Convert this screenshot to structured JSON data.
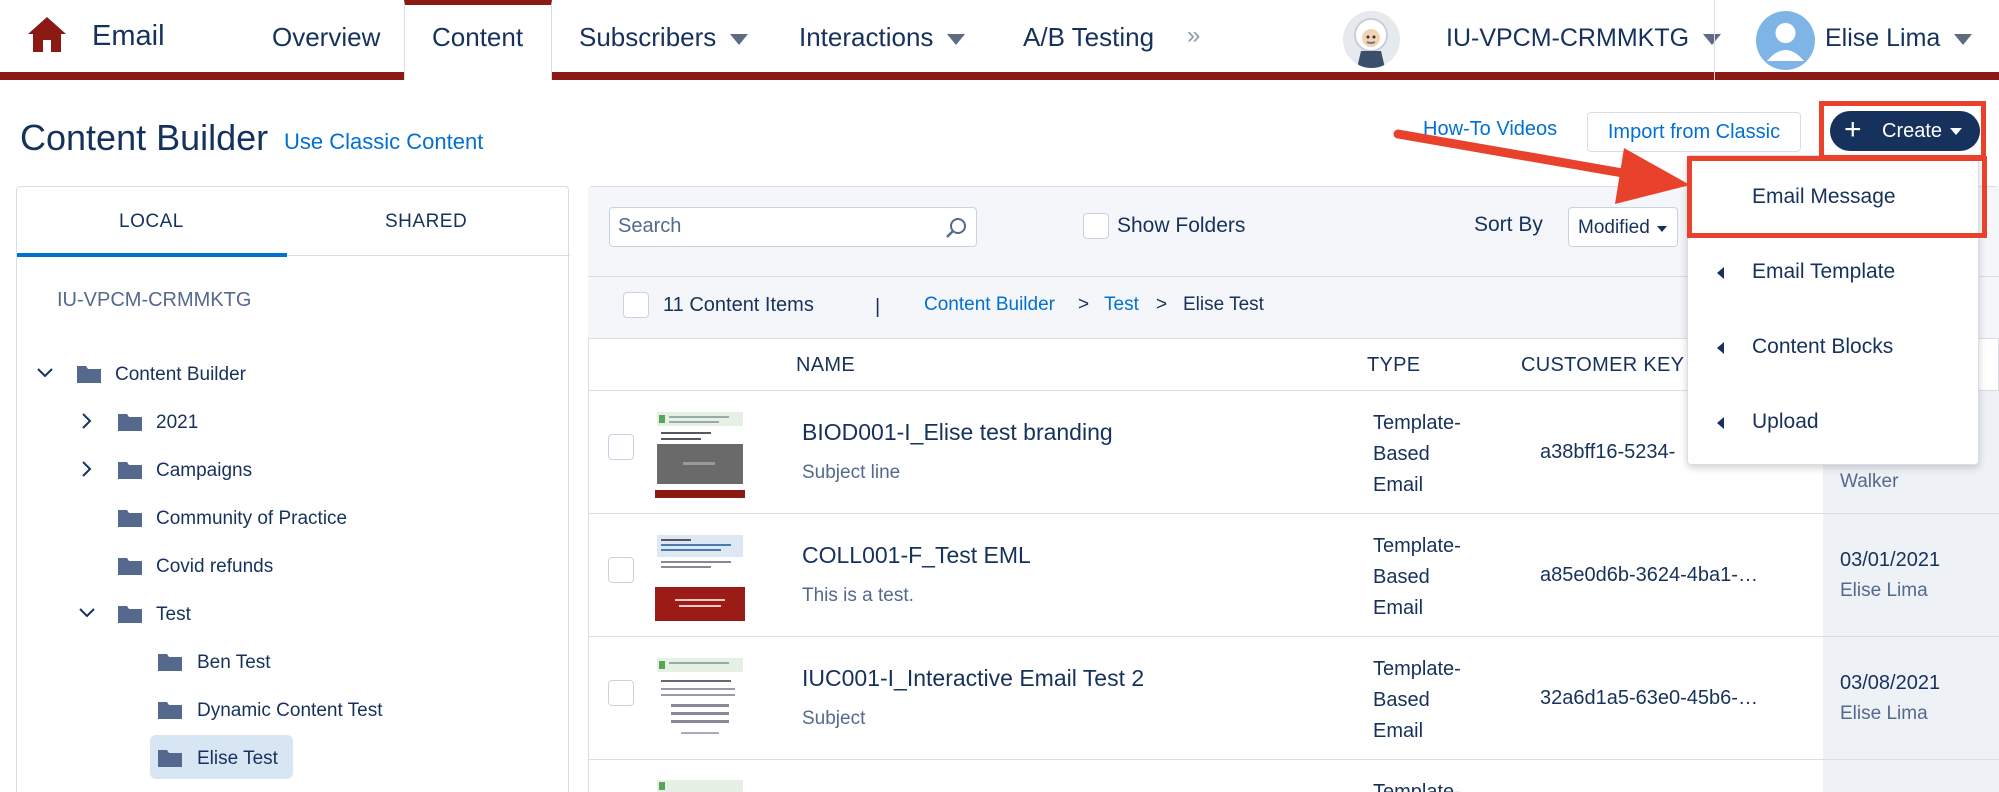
{
  "nav": {
    "app_name": "Email",
    "tabs": [
      {
        "label": "Overview",
        "active": false,
        "has_caret": false
      },
      {
        "label": "Content",
        "active": true,
        "has_caret": false
      },
      {
        "label": "Subscribers",
        "active": false,
        "has_caret": true
      },
      {
        "label": "Interactions",
        "active": false,
        "has_caret": true
      },
      {
        "label": "A/B Testing",
        "active": false,
        "has_caret": false
      }
    ],
    "more_glyph": "»",
    "org_name": "IU-VPCM-CRMMKTG",
    "user_name": "Elise Lima",
    "icons": {
      "home": "home-icon",
      "org": "einstein-avatar",
      "user": "user-avatar-icon"
    }
  },
  "header": {
    "title": "Content Builder",
    "classic_link": "Use Classic Content",
    "howto_link": "How-To Videos",
    "import_button": "Import from Classic",
    "create_button": "Create"
  },
  "left_panel": {
    "tabs": [
      "LOCAL",
      "SHARED"
    ],
    "active_tab": "LOCAL",
    "org_label": "IU-VPCM-CRMMKTG",
    "tree": [
      {
        "label": "Content Builder",
        "level": 0,
        "expanded": true
      },
      {
        "label": "2021",
        "level": 1,
        "collapsed": true
      },
      {
        "label": "Campaigns",
        "level": 1,
        "collapsed": true
      },
      {
        "label": "Community of Practice",
        "level": 1
      },
      {
        "label": "Covid refunds",
        "level": 1
      },
      {
        "label": "Test",
        "level": 1,
        "expanded": true
      },
      {
        "label": "Ben Test",
        "level": 2
      },
      {
        "label": "Dynamic Content Test",
        "level": 2
      },
      {
        "label": "Elise Test",
        "level": 2,
        "selected": true
      }
    ]
  },
  "toolbar": {
    "search_placeholder": "Search",
    "show_folders": "Show Folders",
    "sort_by_label": "Sort By",
    "sort_value": "Modified"
  },
  "list": {
    "count_label": "11 Content Items",
    "separator": "|",
    "breadcrumb": [
      "Content Builder",
      "Test",
      "Elise Test"
    ],
    "crumb_sep": ">",
    "columns": [
      "NAME",
      "TYPE",
      "CUSTOMER KEY"
    ],
    "rows": [
      {
        "name": "BIOD001-I_Elise test branding",
        "subject": "Subject line",
        "type": "Template-Based Email",
        "key": "a38bff16-5234-",
        "date": "",
        "by": "Walker"
      },
      {
        "name": "COLL001-F_Test EML",
        "subject": "This is a test.",
        "type": "Template-Based Email",
        "key": "a85e0d6b-3624-4ba1-…",
        "date": "03/01/2021",
        "by": "Elise Lima"
      },
      {
        "name": "IUC001-I_Interactive Email Test 2",
        "subject": "Subject",
        "type": "Template-Based Email",
        "key": "32a6d1a5-63e0-45b6-…",
        "date": "03/08/2021",
        "by": "Elise Lima"
      },
      {
        "name": "",
        "subject": "",
        "type": "Template-",
        "key": "",
        "date": "",
        "by": ""
      }
    ]
  },
  "create_menu": {
    "items": [
      "Email Message",
      "Email Template",
      "Content Blocks",
      "Upload"
    ]
  },
  "colors": {
    "brand_navy": "#16325c",
    "nav_accent": "#8b1a15",
    "link_blue": "#0070d2",
    "highlight_red": "#e8412c"
  }
}
